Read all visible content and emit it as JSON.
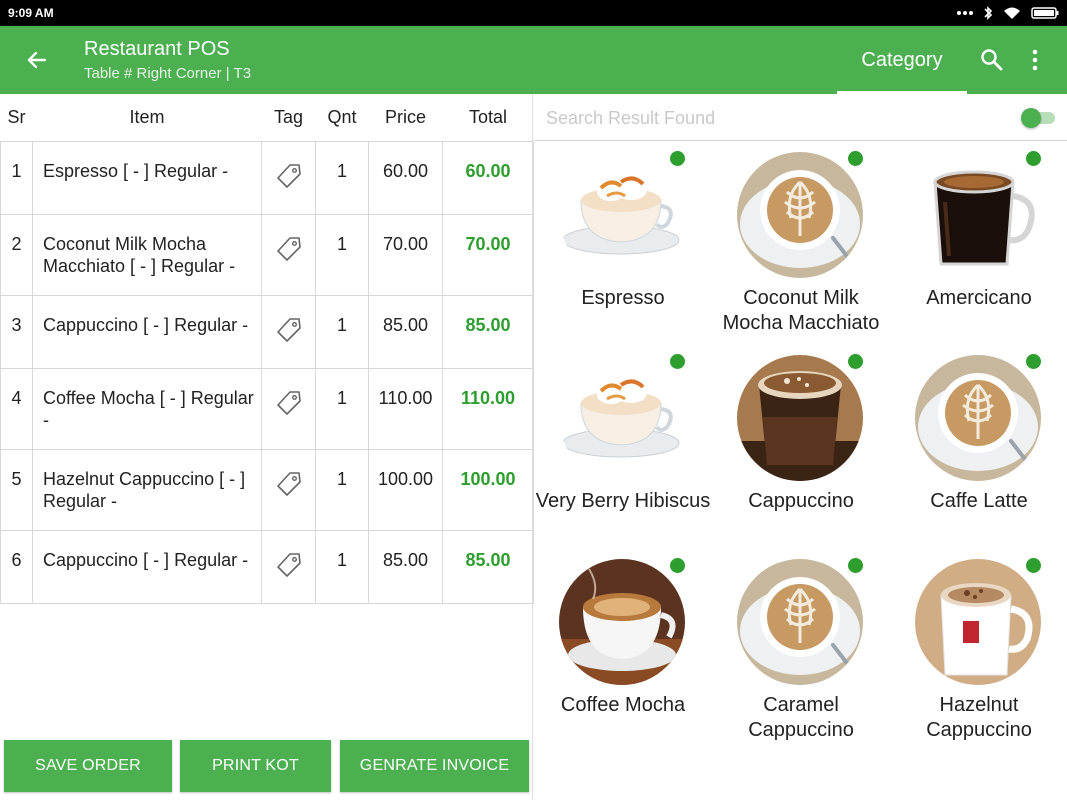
{
  "status_bar": {
    "time": "9:09 AM"
  },
  "app_bar": {
    "title": "Restaurant POS",
    "subtitle": "Table # Right Corner | T3",
    "tab_category": "Category"
  },
  "order_table": {
    "headers": {
      "sr": "Sr",
      "item": "Item",
      "tag": "Tag",
      "qnt": "Qnt",
      "price": "Price",
      "total": "Total"
    },
    "rows": [
      {
        "sr": "1",
        "item": "Espresso [ - ] Regular -",
        "qnt": "1",
        "price": "60.00",
        "total": "60.00"
      },
      {
        "sr": "2",
        "item": "Coconut Milk Mocha Macchiato [ - ] Regular -",
        "qnt": "1",
        "price": "70.00",
        "total": "70.00"
      },
      {
        "sr": "3",
        "item": "Cappuccino [ - ] Regular -",
        "qnt": "1",
        "price": "85.00",
        "total": "85.00"
      },
      {
        "sr": "4",
        "item": "Coffee Mocha [ - ] Regular -",
        "qnt": "1",
        "price": "110.00",
        "total": "110.00"
      },
      {
        "sr": "5",
        "item": "Hazelnut Cappuccino [ - ] Regular -",
        "qnt": "1",
        "price": "100.00",
        "total": "100.00"
      },
      {
        "sr": "6",
        "item": "Cappuccino [ - ] Regular -",
        "qnt": "1",
        "price": "85.00",
        "total": "85.00"
      }
    ]
  },
  "buttons": {
    "save": "SAVE ORDER",
    "print": "PRINT KOT",
    "invoice": "GENRATE INVOICE"
  },
  "search": {
    "placeholder": "Search Result Found"
  },
  "products": [
    {
      "name": "Espresso",
      "image": "espresso-cup-icon"
    },
    {
      "name": "Coconut Milk Mocha Macchiato",
      "image": "latte-art-cup-icon"
    },
    {
      "name": "Amercicano",
      "image": "black-coffee-mug-icon"
    },
    {
      "name": "Very Berry Hibiscus",
      "image": "espresso-cup-icon"
    },
    {
      "name": "Cappuccino",
      "image": "cappuccino-glass-icon"
    },
    {
      "name": "Caffe Latte",
      "image": "latte-art-cup-icon"
    },
    {
      "name": "Coffee Mocha",
      "image": "mocha-cup-icon"
    },
    {
      "name": "Caramel Cappuccino",
      "image": "latte-art-cup-icon"
    },
    {
      "name": "Hazelnut Cappuccino",
      "image": "branded-mug-icon"
    }
  ],
  "colors": {
    "primary": "#4caf50",
    "total_text": "#2e9e2e",
    "available_dot": "#2e9e2e"
  }
}
